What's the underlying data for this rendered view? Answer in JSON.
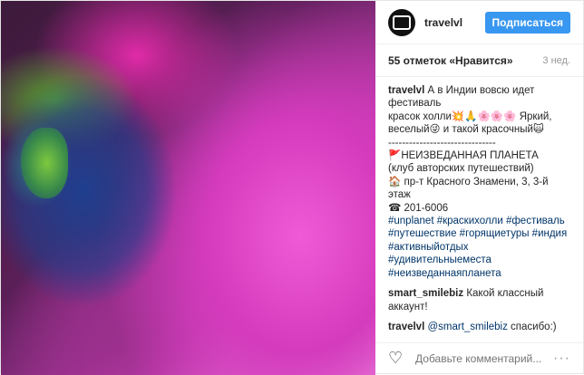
{
  "header": {
    "username": "travelvl",
    "follow_label": "Подписаться"
  },
  "meta": {
    "likes": "55 отметок «Нравится»",
    "time": "3 нед."
  },
  "caption": {
    "author": "travelvl",
    "line1": "А в Индии вовсю идет фестиваль",
    "line2": "красок холли💥🙏🌸🌸🌸 Яркий,",
    "line3": "веселый😜 и такой красочный🙀",
    "divider": "-------------------------------",
    "title": "🚩НЕИЗВЕДАННАЯ ПЛАНЕТА",
    "club": "(клуб авторских путешествий)",
    "address": "🏠 пр-т Красного Знамени, 3, 3-й этаж",
    "phone": "☎ 201-6006",
    "tags": [
      "#unplanet #краскихолли #фестиваль",
      "#путешествие #горящиетуры #индия",
      "#активныйотдых #удивительныеместа",
      "#неизведаннаяпланета"
    ]
  },
  "comment1": {
    "author": "smart_smilebiz",
    "text": "Какой классный аккаунт!"
  },
  "comment2": {
    "author": "travelvl",
    "mention": "@smart_smilebiz",
    "text": "спасибо:)"
  },
  "add_comment": {
    "placeholder": "Добавьте комментарий..."
  },
  "icons": {
    "like": "heart-icon",
    "more": "ellipsis-icon"
  }
}
